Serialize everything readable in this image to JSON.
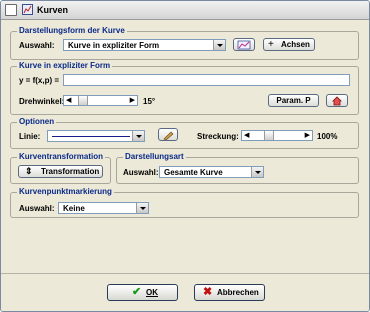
{
  "window": {
    "title": "Kurven"
  },
  "representation": {
    "legend": "Darstellungsform der Kurve",
    "select_label": "Auswahl:",
    "select_value": "Kurve in expliziter Form",
    "axes_button": "Achsen"
  },
  "explicit": {
    "legend": "Kurve in expliziter Form",
    "function_label": "y = f(x,p) =",
    "function_value": "",
    "rotation_label": "Drehwinkel:",
    "rotation_value": "15°",
    "param_button": "Param. P"
  },
  "options": {
    "legend": "Optionen",
    "line_label": "Linie:",
    "stretch_label": "Streckung:",
    "stretch_value": "100%"
  },
  "transform": {
    "legend": "Kurventransformation",
    "button": "Transformation"
  },
  "display": {
    "legend": "Darstellungsart",
    "select_label": "Auswahl:",
    "select_value": "Gesamte Kurve"
  },
  "marking": {
    "legend": "Kurvenpunktmarkierung",
    "select_label": "Auswahl:",
    "select_value": "Keine"
  },
  "footer": {
    "ok_label": "OK",
    "cancel_label": "Abbrechen"
  }
}
